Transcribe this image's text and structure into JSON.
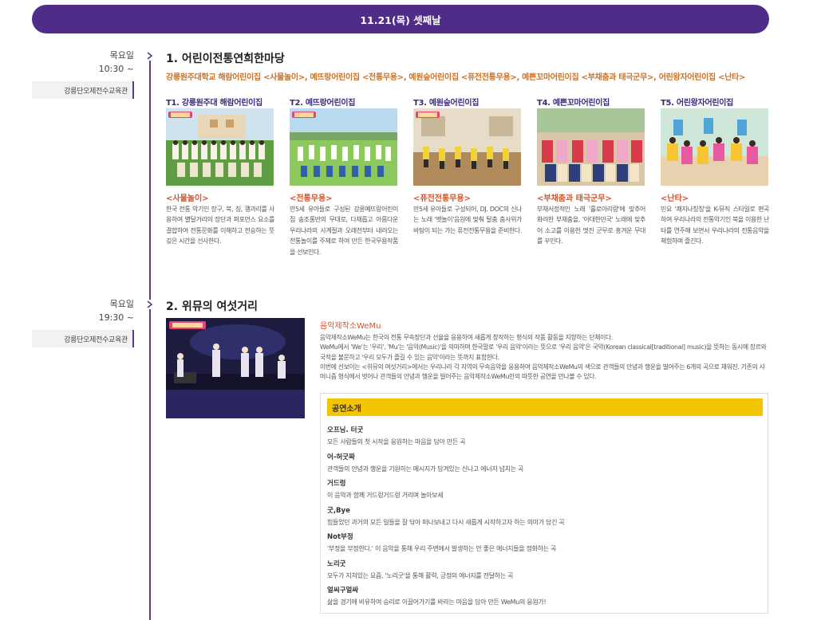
{
  "day_banner": "11.21(목) 셋째날",
  "events": [
    {
      "dow": "목요일",
      "time": "10:30 ~",
      "venue": "강릉단오제전수교육관",
      "title": "1. 어린이전통연희한마당",
      "subtitle": "강릉원주대학교 해람어린이집 <사물놀이>, 예뜨랑어린이집 <전통무용>, 예원숲어린이집 <퓨전전통무용>, 예쁜꼬마어린이집 <부채춤과 태극군무>, 어린왕자어린이집 <난타>",
      "teams": [
        {
          "label": "T1. 강릉원주대 해람어린이집",
          "program": "<사물놀이>",
          "desc": "한국 전통 악기인 장구, 북, 징, 꽹과리를 사용하여 별달거리의 장단과 퍼포먼스 요소를 결합하여 전통문화를 이해하고 전승하는 뜻 깊은 시간을 선사한다."
        },
        {
          "label": "T2. 예뜨랑어린이집",
          "program": "<전통무용>",
          "desc": "만5세 유아들로 구성된 강릉예뜨랑어린이집 송조롱반의 무대로, 다채롭고 아름다운 우리나라의 사계절과 오래전부터 내려오는 전통놀이를 주제로 하여 만든 한국무용작품을 선보인다."
        },
        {
          "label": "T3. 예원숲어린이집",
          "program": "<퓨전전통무용>",
          "desc": "만5세 유아들로 구성되어, DJ. DOC의 신나는 노래 '뱃놀이'음원에 맞춰 탈춤 춤사위가 바탕이 되는 가는 퓨전전통무용을 준비한다."
        },
        {
          "label": "T4. 예쁜꼬마어린이집",
          "program": "<부채춤과 태극군무>",
          "desc": "부채서정적인 노래 '홀로아리랑'에 맞추어 화려한 부채춤을, '아대한민국' 노래에 맞추어 소고를 이용한 멋진 군무로 흥겨운 무대를 꾸민다."
        },
        {
          "label": "T5. 어린왕자어린이집",
          "program": "<난타>",
          "desc": "민요 '쾌지나칭칭'을 K-뮤직 스타일로 편곡하여 우리나라의 전통악기인 북을 이용한 난타를 연주해 보면서 우리나라의 전통음악을 체험하며 즐긴다."
        }
      ]
    },
    {
      "dow": "목요일",
      "time": "19:30 ~",
      "venue": "강릉단오제전수교육관",
      "title": "2. 위뮤의 여섯거리",
      "group_name": "음악제작소WeMu",
      "desc": [
        "음악제작소WeMu는 한국의 전통 무속장단과 선율을 응용하여 새롭게 창작하는 형식의 작품 활동을 지향하는 단체이다.",
        "WeMu에서 'We'는 '우리', 'Mu'는 '음악(Music)'을 의미하며 한국말로 '우리 음악'이라는 뜻으로 '우리 음악'은 국악(Korean classical[traditional] music)을 뜻하는 동시에 장르와 국적을 불문하고 '우리 모두가 즐길 수 있는 음악'이라는 뜻까지 표함한다.",
        "이번에 선보이는 <위뮤의 여섯거리>에서는 우리나라 각 지역의 무속음악을 응용하여 음악제작소WeMu의 색으로 관객들의 안녕과 행운을 빌어주는 6개의 곡으로 채워진. 기존의 샤머니즘 형식에서 벗어나 관객들의 안녕과 행운을 빌어주는 음악제작소WeMu만의 따뜻한 공연을 만나볼 수 있다."
      ],
      "perf_header": "공연소개",
      "performances": [
        {
          "name": "오프닝. 터굿",
          "desc": "모든 사람들의 첫 시작을 응원하는 마음을 담아 만든 곡"
        },
        {
          "name": "어-허굿짜",
          "desc": "관객들의 안녕과 행운을 기원하는 메시지가 담겨있는 신나고 에너지 넘치는 곡"
        },
        {
          "name": "거드렁",
          "desc": "이 음악과 함께 거드렁거드렁 거리며 놀아보세"
        },
        {
          "name": "굿,Bye",
          "desc": "힘들었던 과거의 모든 일들을 잘 닦아 떠나보내고 다시 새롭게 시작하고자 하는 의미가 담긴 곡"
        },
        {
          "name": "Not부정",
          "desc": "'부정을 부정한다.' 이 음악을 통해 우리 주변에서 발생하는 안 좋은 에너지들을 정화하는 곡"
        },
        {
          "name": "노리굿",
          "desc": "모두가 지쳐있는 요즘, '노리굿'을 통해 활력, 긍정의 에너지를 전달하는 곡"
        },
        {
          "name": "얼씨구얼싸",
          "desc": "삶을 경기에 비유하여 승리로 이끌어가기를 바라는 마음을 담아 만든 WeMu의 응원가!"
        }
      ]
    }
  ]
}
